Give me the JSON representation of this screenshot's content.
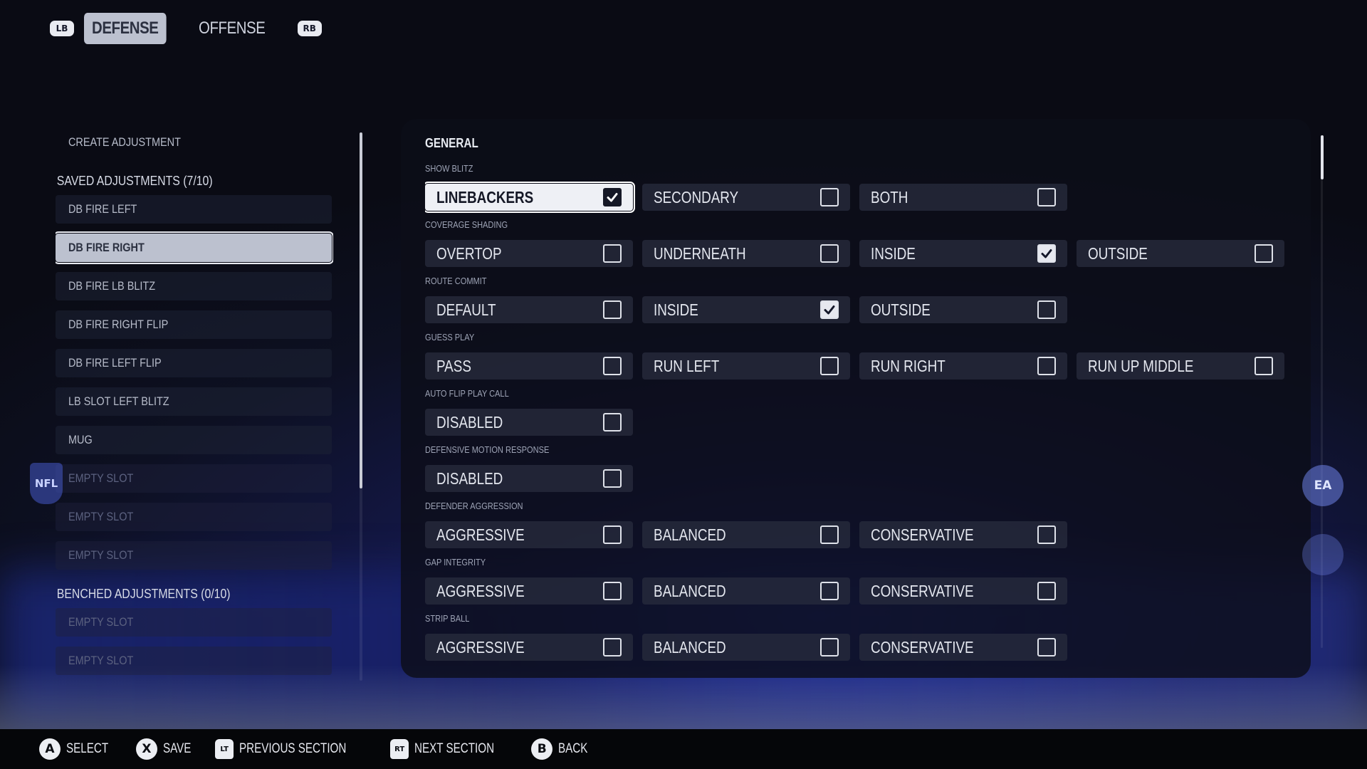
{
  "tabs": {
    "left_bumper": "LB",
    "right_bumper": "RB",
    "items": [
      {
        "label": "DEFENSE",
        "active": true
      },
      {
        "label": "OFFENSE",
        "active": false
      }
    ]
  },
  "sidebar": {
    "create_label": "CREATE ADJUSTMENT",
    "saved_header": "SAVED ADJUSTMENTS (7/10)",
    "saved": [
      "DB FIRE LEFT",
      "DB FIRE RIGHT",
      "DB FIRE LB BLITZ",
      "DB FIRE RIGHT FLIP",
      "DB FIRE LEFT FLIP",
      "LB SLOT LEFT BLITZ",
      "MUG",
      "EMPTY SLOT",
      "EMPTY SLOT",
      "EMPTY SLOT"
    ],
    "benched_header": "BENCHED ADJUSTMENTS (0/10)",
    "benched": [
      "EMPTY SLOT",
      "EMPTY SLOT"
    ]
  },
  "panel": {
    "section_title": "GENERAL",
    "groups": [
      {
        "label": "SHOW BLITZ",
        "options": [
          {
            "label": "LINEBACKERS",
            "checked": true
          },
          {
            "label": "SECONDARY",
            "checked": false
          },
          {
            "label": "BOTH",
            "checked": false
          }
        ]
      },
      {
        "label": "COVERAGE SHADING",
        "options": [
          {
            "label": "OVERTOP",
            "checked": false
          },
          {
            "label": "UNDERNEATH",
            "checked": false
          },
          {
            "label": "INSIDE",
            "checked": true
          },
          {
            "label": "OUTSIDE",
            "checked": false
          }
        ]
      },
      {
        "label": "ROUTE COMMIT",
        "options": [
          {
            "label": "DEFAULT",
            "checked": false
          },
          {
            "label": "INSIDE",
            "checked": true
          },
          {
            "label": "OUTSIDE",
            "checked": false
          }
        ]
      },
      {
        "label": "GUESS PLAY",
        "options": [
          {
            "label": "PASS",
            "checked": false
          },
          {
            "label": "RUN LEFT",
            "checked": false
          },
          {
            "label": "RUN RIGHT",
            "checked": false
          },
          {
            "label": "RUN UP MIDDLE",
            "checked": false
          }
        ]
      },
      {
        "label": "AUTO FLIP PLAY CALL",
        "options": [
          {
            "label": "DISABLED",
            "checked": false
          }
        ]
      },
      {
        "label": "DEFENSIVE MOTION RESPONSE",
        "options": [
          {
            "label": "DISABLED",
            "checked": false
          }
        ]
      },
      {
        "label": "DEFENDER AGGRESSION",
        "options": [
          {
            "label": "AGGRESSIVE",
            "checked": false
          },
          {
            "label": "BALANCED",
            "checked": false
          },
          {
            "label": "CONSERVATIVE",
            "checked": false
          }
        ]
      },
      {
        "label": "GAP INTEGRITY",
        "options": [
          {
            "label": "AGGRESSIVE",
            "checked": false
          },
          {
            "label": "BALANCED",
            "checked": false
          },
          {
            "label": "CONSERVATIVE",
            "checked": false
          }
        ]
      },
      {
        "label": "STRIP BALL",
        "options": [
          {
            "label": "AGGRESSIVE",
            "checked": false
          },
          {
            "label": "BALANCED",
            "checked": false
          },
          {
            "label": "CONSERVATIVE",
            "checked": false
          }
        ]
      }
    ]
  },
  "footer": {
    "select": {
      "button": "A",
      "label": "SELECT"
    },
    "save": {
      "button": "X",
      "label": "SAVE"
    },
    "prev": {
      "button": "LT",
      "label": "PREVIOUS SECTION"
    },
    "next": {
      "button": "RT",
      "label": "NEXT SECTION"
    },
    "back": {
      "button": "B",
      "label": "BACK"
    }
  },
  "logos": {
    "nfl": "NFL",
    "ea": "EA"
  }
}
